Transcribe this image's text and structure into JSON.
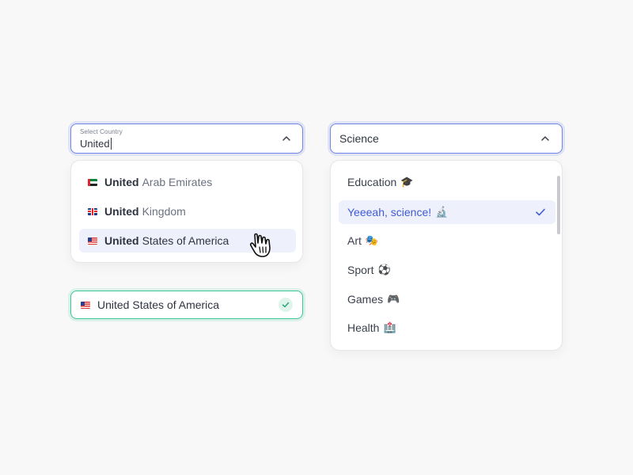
{
  "country_select": {
    "label": "Select Country",
    "query": "United",
    "options": [
      {
        "flag": "uae-flag-icon",
        "match": "United",
        "rest": "Arab Emirates"
      },
      {
        "flag": "uk-flag-icon",
        "match": "United",
        "rest": "Kingdom"
      },
      {
        "flag": "us-flag-icon",
        "match": "United",
        "rest": "States of America",
        "highlighted": true
      }
    ]
  },
  "selected_country": {
    "flag": "us-flag-icon",
    "value": "United States of America",
    "status_icon": "check-circle-icon"
  },
  "category_select": {
    "value": "Science",
    "options": [
      {
        "label": "Education",
        "emoji": "🎓"
      },
      {
        "label": "Yeeeah, science!",
        "emoji": "🔬",
        "selected": true
      },
      {
        "label": "Art",
        "emoji": "🎭"
      },
      {
        "label": "Sport",
        "emoji": "⚽"
      },
      {
        "label": "Games",
        "emoji": "🎮"
      },
      {
        "label": "Health",
        "emoji": "🏥"
      }
    ]
  },
  "colors": {
    "focus_border": "#6f86e6",
    "success_border": "#3cc49a",
    "highlight_bg": "#eef1fb",
    "selected_text": "#3f5bd6"
  }
}
